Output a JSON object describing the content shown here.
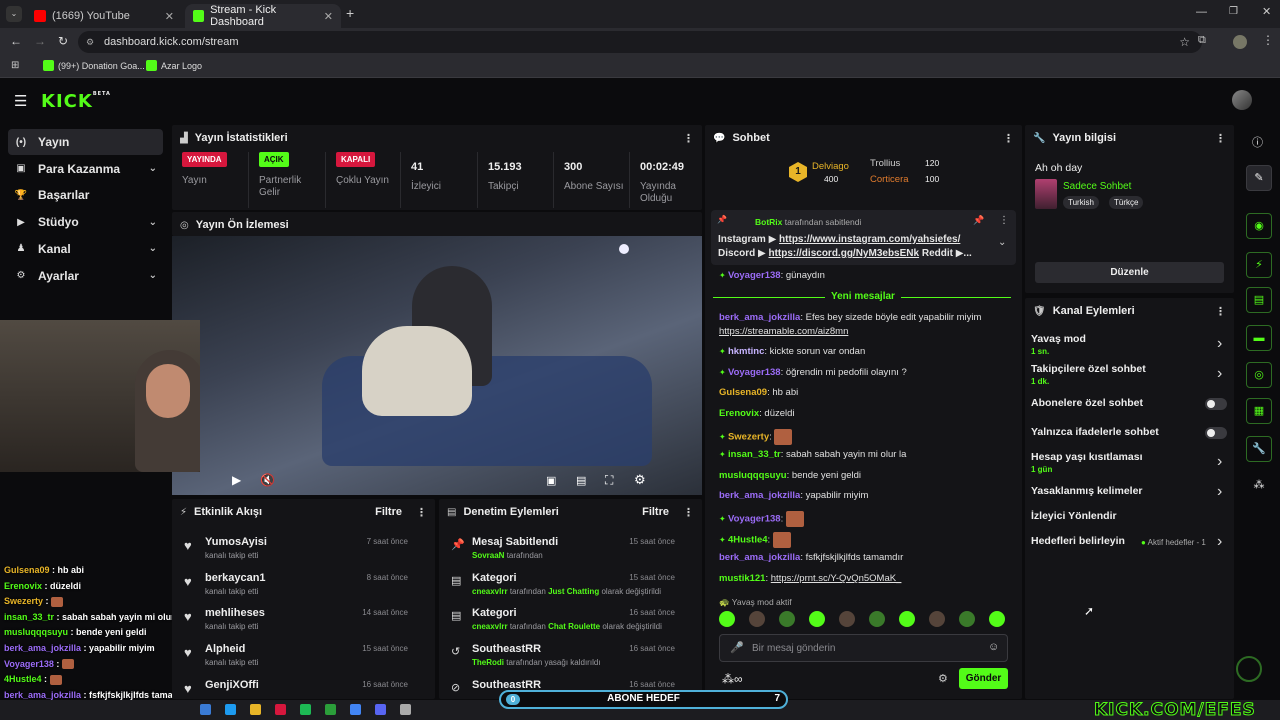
{
  "browser": {
    "tabs": [
      {
        "label": "(1669) YouTube",
        "fav_color": "#ff0000"
      },
      {
        "label": "Stream - Kick Dashboard",
        "fav_color": "#53fc18"
      }
    ],
    "url": "dashboard.kick.com/stream",
    "bookmarks": [
      {
        "label": "(99+) Donation Goa...",
        "color": "#53fc18"
      },
      {
        "label": "Azar Logo",
        "color": "#53fc18"
      }
    ]
  },
  "kick": {
    "logo": "KICK",
    "beta": "BETA"
  },
  "sidebar": {
    "items": [
      {
        "label": "Yayın",
        "icon": "broadcast-icon",
        "glyph": "(•)",
        "active": true,
        "chev": false
      },
      {
        "label": "Para Kazanma",
        "icon": "money-icon",
        "glyph": "▣",
        "active": false,
        "chev": true
      },
      {
        "label": "Başarılar",
        "icon": "trophy-icon",
        "glyph": "🏆",
        "active": false,
        "chev": false
      },
      {
        "label": "Stüdyo",
        "icon": "studio-icon",
        "glyph": "▶",
        "active": false,
        "chev": true
      },
      {
        "label": "Kanal",
        "icon": "channel-icon",
        "glyph": "♟",
        "active": false,
        "chev": true
      },
      {
        "label": "Ayarlar",
        "icon": "gear-icon",
        "glyph": "⚙",
        "active": false,
        "chev": true
      }
    ]
  },
  "stats": {
    "title": "Yayın İstatistikleri",
    "items": [
      {
        "badge": "YAYINDA",
        "badge_color": "#d6173d",
        "label": "Yayın"
      },
      {
        "badge": "AÇIK",
        "badge_color": "#53fc18",
        "badge_text_color": "#0b0b0d",
        "label": "Partnerlik Gelir"
      },
      {
        "badge": "KAPALI",
        "badge_color": "#d6173d",
        "label": "Çoklu Yayın"
      },
      {
        "value": "41",
        "label": "İzleyici"
      },
      {
        "value": "15.193",
        "label": "Takipçi"
      },
      {
        "value": "300",
        "label": "Abone Sayısı"
      },
      {
        "value": "00:02:49",
        "label": "Yayında Olduğu"
      }
    ]
  },
  "preview": {
    "title": "Yayın Ön İzlemesi"
  },
  "activity": {
    "title": "Etkinlik Akışı",
    "filter": "Filtre",
    "items": [
      {
        "name": "YumosAyisi",
        "sub": "kanalı takip etti",
        "time": "7 saat önce"
      },
      {
        "name": "berkaycan1",
        "sub": "kanalı takip etti",
        "time": "8 saat önce"
      },
      {
        "name": "mehliheses",
        "sub": "kanalı takip etti",
        "time": "14 saat önce"
      },
      {
        "name": "Alpheid",
        "sub": "kanalı takip etti",
        "time": "15 saat önce"
      },
      {
        "name": "GenjiXOffi",
        "sub": "",
        "time": "16 saat önce"
      }
    ]
  },
  "moderation": {
    "title": "Denetim Eylemleri",
    "filter": "Filtre",
    "items": [
      {
        "icon": "pin-icon",
        "glyph": "📌",
        "name": "Mesaj Sabitlendi",
        "actor": "SovraaN",
        "rest": "tarafından",
        "mid": "",
        "end": "",
        "time": "15 saat önce"
      },
      {
        "icon": "category-icon",
        "glyph": "▤",
        "name": "Kategori",
        "actor": "cneaxvlrr",
        "rest": "tarafından",
        "mid": "Just Chatting",
        "end": "olarak değiştirildi",
        "time": "15 saat önce"
      },
      {
        "icon": "category-icon",
        "glyph": "▤",
        "name": "Kategori",
        "actor": "cneaxvlrr",
        "rest": "tarafından",
        "mid": "Chat Roulette",
        "end": "olarak değiştirildi",
        "time": "16 saat önce"
      },
      {
        "icon": "unban-icon",
        "glyph": "↺",
        "name": "SoutheastRR",
        "actor": "TheRodi",
        "rest": "tarafından yasağı kaldırıldı",
        "mid": "",
        "end": "",
        "time": "16 saat önce"
      },
      {
        "icon": "ban-icon",
        "glyph": "⊘",
        "name": "SoutheastRR",
        "actor": "",
        "rest": "",
        "mid": "",
        "end": "",
        "time": "16 saat önce"
      }
    ]
  },
  "chat": {
    "title": "Sohbet",
    "leaders": [
      {
        "name": "Delviago",
        "val": "400",
        "color": "#e8b528"
      },
      {
        "name": "Trollius",
        "val": "120",
        "color": "#cfcfcf"
      },
      {
        "name": "Corticera",
        "val": "100",
        "color": "#e07b2d"
      }
    ],
    "pinned": {
      "by": "BotRix",
      "by_suffix": "tarafından sabitlendi",
      "line1_label": "Instagram ▶",
      "line1_link": "https://www.instagram.com/yahsiefes/",
      "line2_label": "Discord ▶",
      "line2_link": "https://discord.gg/NyM3ebsENk",
      "line2_tail": "Reddit ▶..."
    },
    "new_label": "Yeni mesajlar",
    "messages": [
      {
        "user": "Voyager138",
        "color": "#9b6cf7",
        "text": "günaydın"
      },
      {
        "user": "berk_ama_jokzilla",
        "color": "#9b6cf7",
        "text": "Efes bey sizede böyle edit yapabilir miyim"
      },
      {
        "user": "",
        "color": "",
        "text": "https://streamable.com/aiz8mn"
      },
      {
        "user": "hkmtinc",
        "color": "#c7b4ff",
        "text": "kickte sorun var ondan"
      },
      {
        "user": "Voyager138",
        "color": "#9b6cf7",
        "text": "öğrendin mi pedofili olayını ?"
      },
      {
        "user": "Gulsena09",
        "color": "#e8b528",
        "text": "hb abi"
      },
      {
        "user": "Erenovix",
        "color": "#53fc18",
        "text": "düzeldi"
      },
      {
        "user": "Swezerty",
        "color": "#e8b528",
        "text": ""
      },
      {
        "user": "insan_33_tr",
        "color": "#53fc18",
        "text": "sabah sabah yayin mi olur la"
      },
      {
        "user": "musluqqqsuyu",
        "color": "#53fc18",
        "text": "bende yeni geldi"
      },
      {
        "user": "berk_ama_jokzilla",
        "color": "#9b6cf7",
        "text": "yapabilir miyim"
      },
      {
        "user": "Voyager138",
        "color": "#9b6cf7",
        "text": ""
      },
      {
        "user": "4Hustle4",
        "color": "#53fc18",
        "text": ""
      },
      {
        "user": "berk_ama_jokzilla",
        "color": "#9b6cf7",
        "text": "fsfkjfskjlkjlfds tamamdır"
      },
      {
        "user": "mustik121",
        "color": "#53fc18",
        "text": "https://prnt.sc/Y-QvQn5OMaK_"
      }
    ],
    "slow_mode": "Yavaş mod aktif",
    "input_placeholder": "Bir mesaj gönderin",
    "send": "Gönder"
  },
  "overlay_chat": [
    {
      "user": "Gulsena09",
      "color": "#e8b528",
      "text": "hb abi"
    },
    {
      "user": "Erenovix",
      "color": "#53fc18",
      "text": "düzeldi"
    },
    {
      "user": "Swezerty",
      "color": "#e8b528",
      "text": ""
    },
    {
      "user": "insan_33_tr",
      "color": "#53fc18",
      "text": "sabah sabah yayin mi olur la"
    },
    {
      "user": "musluqqqsuyu",
      "color": "#53fc18",
      "text": "bende yeni geldi"
    },
    {
      "user": "berk_ama_jokzilla",
      "color": "#9b6cf7",
      "text": "yapabilir miyim"
    },
    {
      "user": "Voyager138",
      "color": "#9b6cf7",
      "text": ""
    },
    {
      "user": "4Hustle4",
      "color": "#53fc18",
      "text": ""
    },
    {
      "user": "berk_ama_jokzilla",
      "color": "#9b6cf7",
      "text": "fsfkjfskjlkjlfds tamamdır"
    },
    {
      "user": "mustik121",
      "color": "#53fc18",
      "text": "https://prnt.sc/Y-QvQn5OMaK_"
    }
  ],
  "stream_info": {
    "title": "Yayın bilgisi",
    "stream_title": "Ah oh day",
    "category": "Sadece Sohbet",
    "tags": [
      "Turkish",
      "Türkçe"
    ],
    "edit": "Düzenle"
  },
  "channel_actions": {
    "title": "Kanal Eylemleri",
    "items": [
      {
        "label": "Yavaş mod",
        "sub": "1 sn.",
        "kind": "chev"
      },
      {
        "label": "Takipçilere özel sohbet",
        "sub": "1 dk.",
        "kind": "chev"
      },
      {
        "label": "Abonelere özel sohbet",
        "sub": "",
        "kind": "toggle"
      },
      {
        "label": "Yalnızca ifadelerle sohbet",
        "sub": "",
        "kind": "toggle"
      },
      {
        "label": "Hesap yaşı kısıtlaması",
        "sub": "1 gün",
        "kind": "chev"
      },
      {
        "label": "Yasaklanmış kelimeler",
        "sub": "",
        "kind": "chev"
      },
      {
        "label": "İzleyici Yönlendir",
        "sub": "",
        "kind": "none"
      },
      {
        "label": "Hedefleri belirleyin",
        "sub": "",
        "kind": "chev",
        "extra": "Aktif hedefler - 1"
      }
    ]
  },
  "goal_bar": {
    "label": "ABONE HEDEF",
    "start": "0",
    "end": "7",
    "progress": 0.0
  },
  "watermark": "KICK.COM/EFES",
  "colors": {
    "accent": "#53fc18",
    "bg": "#0b0b0d",
    "panel": "#141417",
    "live": "#d6173d"
  }
}
